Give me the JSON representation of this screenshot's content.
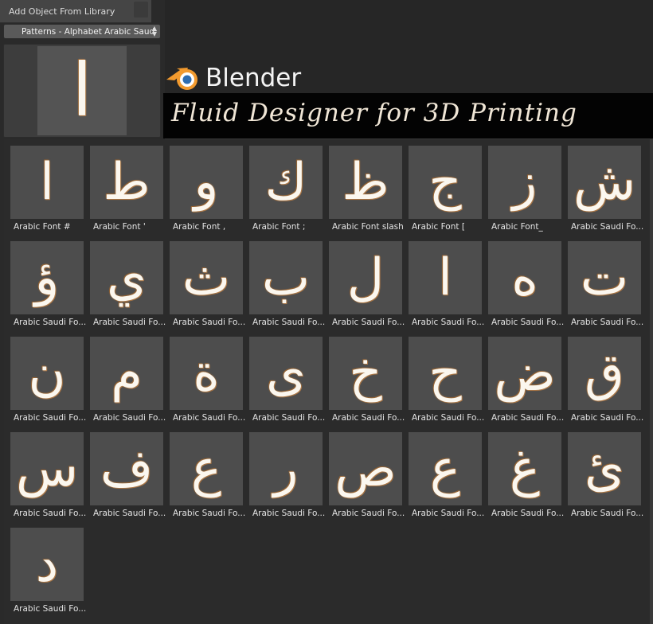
{
  "panel": {
    "title": "Add Object From Library",
    "category": "Patterns - Alphabet Arabic Saud",
    "arrows": "▲\n▼",
    "preview_glyph": "ا"
  },
  "banner": {
    "brand": "Blender",
    "subtitle": "Fluid Designer for 3D Printing"
  },
  "colors": {
    "background": "#1e1e1e",
    "tile": "#4d4d4d",
    "banner": "#030303",
    "logo_orange": "#f29a2e",
    "logo_blue": "#2f6db0"
  },
  "items": [
    {
      "label": "Arabic Font #",
      "glyph": "ا"
    },
    {
      "label": "Arabic Font '",
      "glyph": "ط"
    },
    {
      "label": "Arabic Font ,",
      "glyph": "و"
    },
    {
      "label": "Arabic Font ;",
      "glyph": "ك"
    },
    {
      "label": "Arabic Font slash",
      "glyph": "ظ"
    },
    {
      "label": "Arabic Font [",
      "glyph": "ج"
    },
    {
      "label": "Arabic Font_",
      "glyph": "ز"
    },
    {
      "label": "Arabic Saudi Fo...",
      "glyph": "ش"
    },
    {
      "label": "Arabic Saudi Fo...",
      "glyph": "ؤ"
    },
    {
      "label": "Arabic Saudi Fo...",
      "glyph": "ي"
    },
    {
      "label": "Arabic Saudi Fo...",
      "glyph": "ث"
    },
    {
      "label": "Arabic Saudi Fo...",
      "glyph": "ب"
    },
    {
      "label": "Arabic Saudi Fo...",
      "glyph": "ل"
    },
    {
      "label": "Arabic Saudi Fo...",
      "glyph": "ا"
    },
    {
      "label": "Arabic Saudi Fo...",
      "glyph": "ه"
    },
    {
      "label": "Arabic Saudi Fo...",
      "glyph": "ت"
    },
    {
      "label": "Arabic Saudi Fo...",
      "glyph": "ن"
    },
    {
      "label": "Arabic Saudi Fo...",
      "glyph": "م"
    },
    {
      "label": "Arabic Saudi Fo...",
      "glyph": "ة"
    },
    {
      "label": "Arabic Saudi Fo...",
      "glyph": "ى"
    },
    {
      "label": "Arabic Saudi Fo...",
      "glyph": "خ"
    },
    {
      "label": "Arabic Saudi Fo...",
      "glyph": "ح"
    },
    {
      "label": "Arabic Saudi Fo...",
      "glyph": "ض"
    },
    {
      "label": "Arabic Saudi Fo...",
      "glyph": "ق"
    },
    {
      "label": "Arabic Saudi Fo...",
      "glyph": "س"
    },
    {
      "label": "Arabic Saudi Fo...",
      "glyph": "ف"
    },
    {
      "label": "Arabic Saudi Fo...",
      "glyph": "ع"
    },
    {
      "label": "Arabic Saudi Fo...",
      "glyph": "ر"
    },
    {
      "label": "Arabic Saudi Fo...",
      "glyph": "ص"
    },
    {
      "label": "Arabic Saudi Fo...",
      "glyph": "ع"
    },
    {
      "label": "Arabic Saudi Fo...",
      "glyph": "غ"
    },
    {
      "label": "Arabic Saudi Fo...",
      "glyph": "ئ"
    },
    {
      "label": "Arabic Saudi Fo...",
      "glyph": "د"
    }
  ]
}
